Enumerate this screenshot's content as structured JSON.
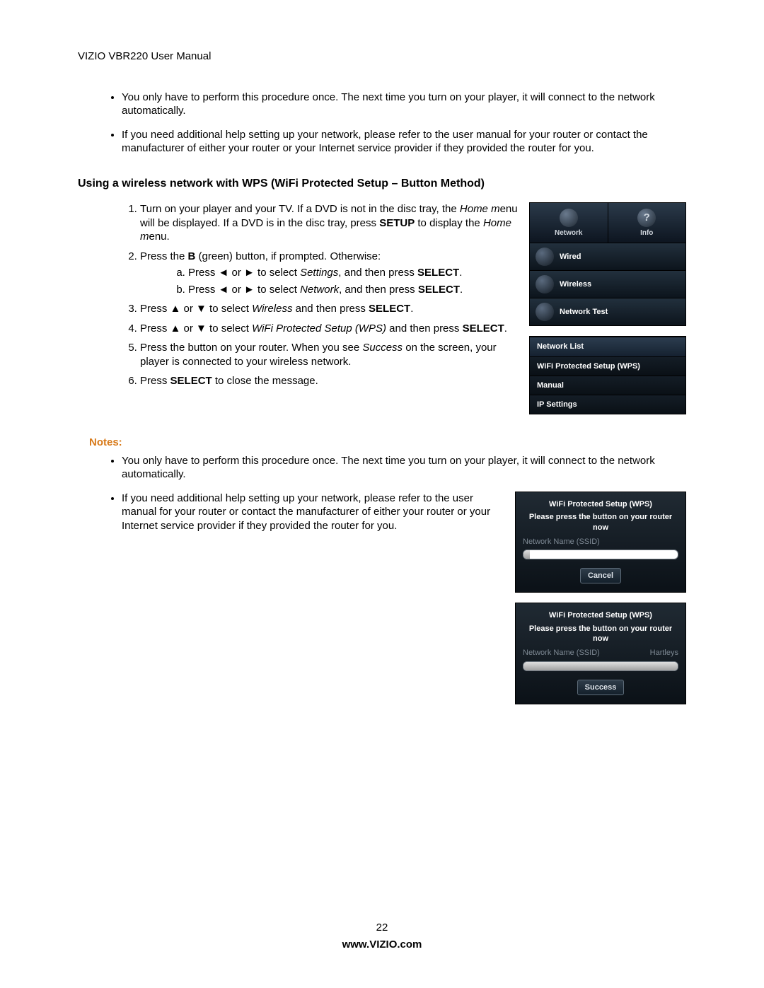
{
  "header": "VIZIO VBR220 User Manual",
  "top_bullets": [
    "You only have to perform this procedure once. The next time you turn on your player, it will connect to the network automatically.",
    "If you need additional help setting up your network, please refer to the user manual for your router or contact the manufacturer of either your router or your Internet service provider if they provided the router for you."
  ],
  "section_title": "Using a wireless network with WPS (WiFi Protected Setup – Button Method)",
  "step1_a": "Turn on your player and your TV. If a DVD is not in the disc tray, the ",
  "step1_home1": "Home m",
  "step1_b": "enu will be displayed. If a DVD is in the disc tray, press ",
  "step1_setup": "SETUP",
  "step1_c": " to display the ",
  "step1_home2": "Home m",
  "step1_d": "enu.",
  "step2_a": "Press the ",
  "step2_B": "B",
  "step2_b": " (green) button, if prompted. Otherwise:",
  "step2_sub_a_1": "Press ◄ or ► to select ",
  "step2_sub_a_i": "Settings",
  "step2_sub_a_2": ", and then press ",
  "step2_sub_a_sel": "SELECT",
  "step2_sub_a_3": ".",
  "step2_sub_b_1": "Press ◄ or ► to select ",
  "step2_sub_b_i": "Network",
  "step2_sub_b_2": ", and then press ",
  "step2_sub_b_sel": "SELECT",
  "step2_sub_b_3": ".",
  "step3_a": "Press ▲ or ▼ to select ",
  "step3_i": "Wireless",
  "step3_b": " and then press ",
  "step3_sel": "SELECT",
  "step3_c": ".",
  "step4_a": "Press ▲ or ▼ to select ",
  "step4_i": "WiFi Protected Setup (WPS)",
  "step4_b": " and then press ",
  "step4_sel": "SELECT",
  "step4_c": ".",
  "step5_a": "Press the button on your router. When you see ",
  "step5_i": "Success",
  "step5_b": " on the screen, your player is connected to your wireless network.",
  "step6_a": "Press ",
  "step6_sel": "SELECT",
  "step6_b": " to close the message.",
  "notes_label": "Notes:",
  "notes_bullet1": "You only have to perform this procedure once. The next time you turn on your player, it will connect to the network automatically.",
  "notes_bullet2": "If you need additional help setting up your network, please refer to the user manual for your router or contact the manufacturer of either your router or your Internet service provider if they provided the router for you.",
  "fig_menu": {
    "tabs": [
      {
        "label": "Network",
        "glyph": ""
      },
      {
        "label": "Info",
        "glyph": "?"
      }
    ],
    "rows": [
      "Wired",
      "Wireless",
      "Network Test"
    ]
  },
  "fig_list": {
    "items": [
      "Network List",
      "WiFi Protected Setup (WPS)",
      "Manual",
      "IP Settings"
    ],
    "active_index": 0
  },
  "fig_dlg1": {
    "title": "WiFi Protected Setup (WPS)",
    "sub": "Please press the button on your router now",
    "ssid_label": "Network Name (SSID)",
    "ssid_value": "",
    "btn": "Cancel"
  },
  "fig_dlg2": {
    "title": "WiFi Protected Setup (WPS)",
    "sub": "Please press the button on your router now",
    "ssid_label": "Network Name (SSID)",
    "ssid_value": "Hartleys",
    "btn": "Success"
  },
  "footer": {
    "page": "22",
    "url": "www.VIZIO.com"
  }
}
